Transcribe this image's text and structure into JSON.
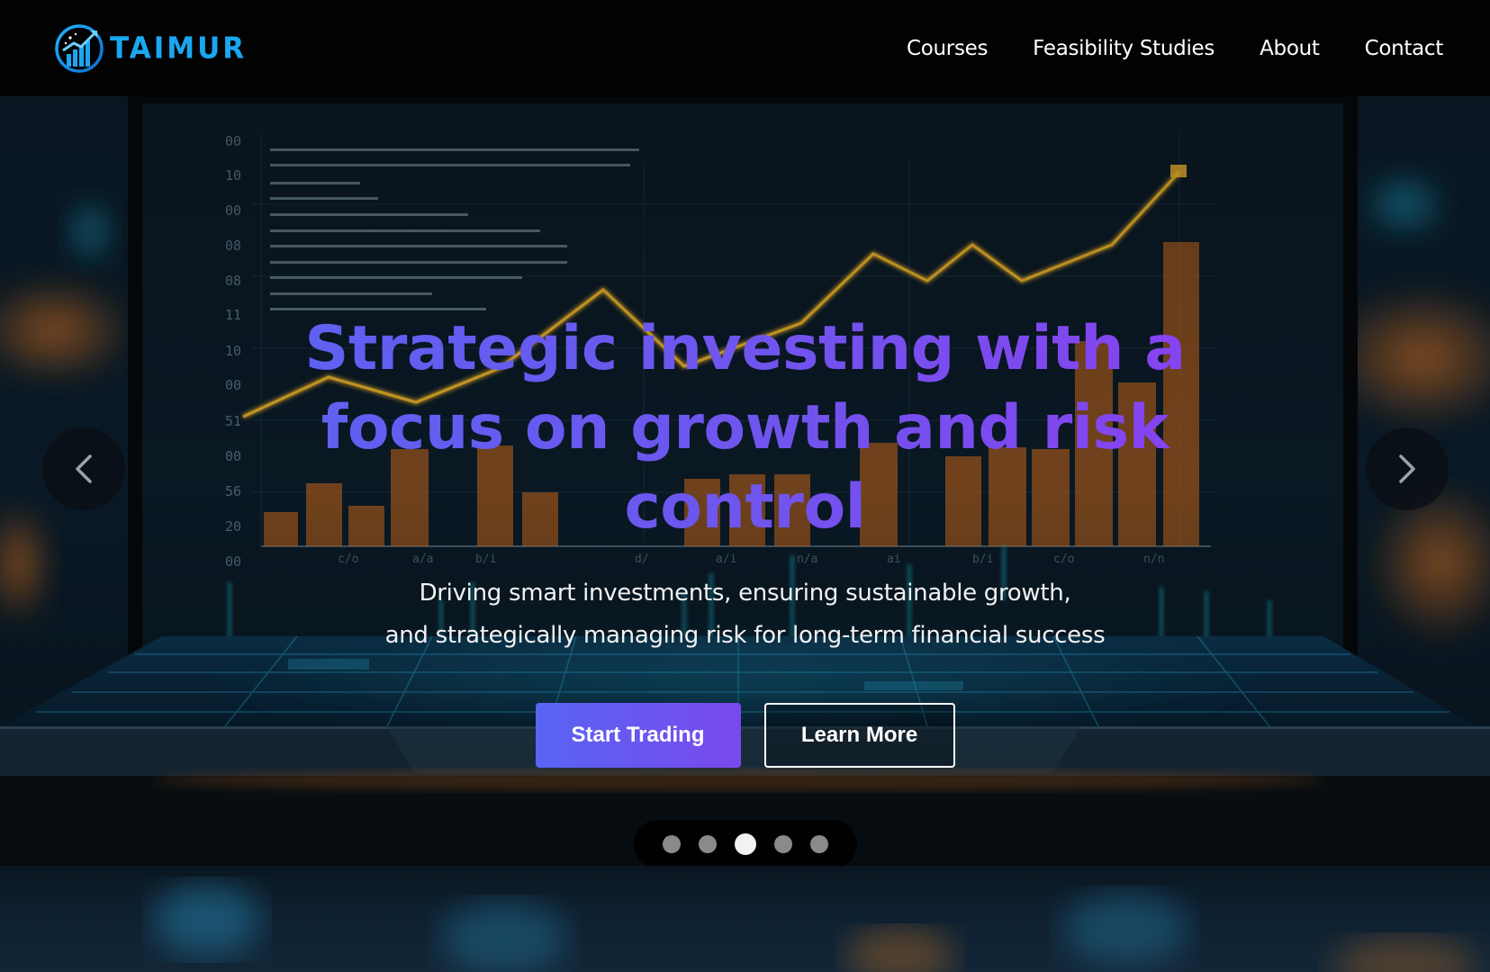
{
  "brand": {
    "name": "TAIMUR",
    "logo_icon": "rocket-chart-icon",
    "accent_color": "#1aa7f0"
  },
  "nav": {
    "links": [
      {
        "label": "Courses"
      },
      {
        "label": "Feasibility Studies"
      },
      {
        "label": "About"
      },
      {
        "label": "Contact"
      }
    ]
  },
  "hero": {
    "title": "Strategic investing with a focus on growth and risk control",
    "subtitle_line1": "Driving smart investments, ensuring sustainable growth,",
    "subtitle_line2": "and strategically managing risk for long-term financial success",
    "primary_button": "Start Trading",
    "secondary_button": "Learn More",
    "gradient_start": "#5b63f2",
    "gradient_end": "#8b3ff0"
  },
  "carousel": {
    "prev_icon": "chevron-left-icon",
    "next_icon": "chevron-right-icon",
    "slide_count": 5,
    "active_index": 2
  }
}
